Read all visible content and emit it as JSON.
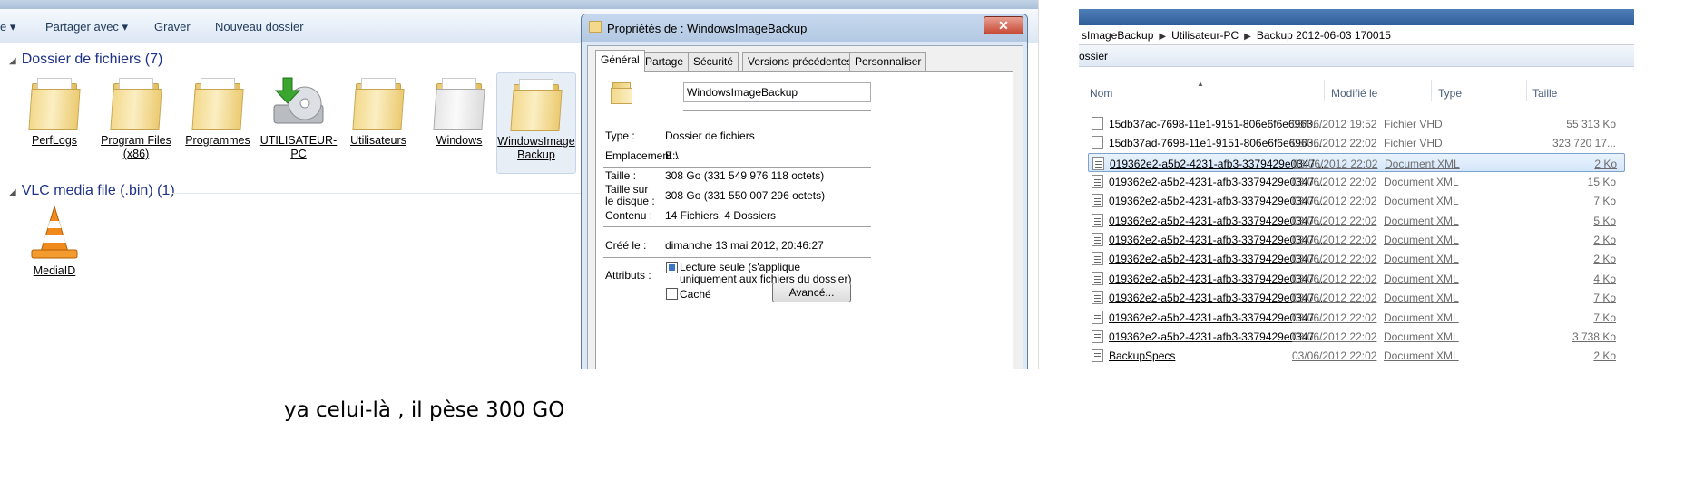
{
  "left_explorer": {
    "toolbar": [
      "e ▾",
      "Partager avec ▾",
      "Graver",
      "Nouveau dossier"
    ],
    "group1": "Dossier de fichiers (7)",
    "folders": [
      "PerfLogs",
      "Program Files (x86)",
      "Programmes",
      "UTILISATEUR-PC",
      "Utilisateurs",
      "Windows",
      "WindowsImageBackup"
    ],
    "group2": "VLC media file (.bin) (1)",
    "media_item": "MediaID"
  },
  "dialog": {
    "title": "Propriétés de : WindowsImageBackup",
    "close_glyph": "✕",
    "tabs": [
      "Général",
      "Partage",
      "Sécurité",
      "Versions précédentes",
      "Personnaliser"
    ],
    "name": "WindowsImageBackup",
    "type_label": "Type :",
    "type_value": "Dossier de fichiers",
    "location_label": "Emplacement :",
    "location_value": "E:\\",
    "size_label": "Taille :",
    "size_value": "308 Go (331 549 976 118 octets)",
    "disk_size_label": "Taille sur le disque :",
    "disk_size_value": "308 Go (331 550 007 296 octets)",
    "contents_label": "Contenu :",
    "contents_value": "14 Fichiers, 4 Dossiers",
    "created_label": "Créé le :",
    "created_value": "dimanche 13 mai 2012, 20:46:27",
    "attributes_label": "Attributs :",
    "readonly_label": "Lecture seule (s'applique uniquement aux fichiers du dossier)",
    "hidden_label": "Caché",
    "advanced_button": "Avancé..."
  },
  "right_explorer": {
    "breadcrumb": [
      "sImageBackup",
      "Utilisateur-PC",
      "Backup 2012-06-03 170015"
    ],
    "toolbar_text": "ossier",
    "columns": [
      "Nom",
      "Modifié le",
      "Type",
      "Taille"
    ],
    "rows": [
      {
        "name": "15db37ac-7698-11e1-9151-806e6f6e6963....",
        "date": "03/06/2012 19:52",
        "type": "Fichier VHD",
        "size": "55 313 Ko",
        "icon": "file-icon"
      },
      {
        "name": "15db37ad-7698-11e1-9151-806e6f6e6963....",
        "date": "03/06/2012 22:02",
        "type": "Fichier VHD",
        "size": "323 720 17...",
        "icon": "file-icon"
      },
      {
        "name": "019362e2-a5b2-4231-afb3-3379429e0347 ...",
        "date": "03/06/2012 22:02",
        "type": "Document XML",
        "size": "2 Ko",
        "icon": "xml-icon"
      },
      {
        "name": "019362e2-a5b2-4231-afb3-3379429e0347 ...",
        "date": "03/06/2012 22:02",
        "type": "Document XML",
        "size": "15 Ko",
        "icon": "xml-icon"
      },
      {
        "name": "019362e2-a5b2-4231-afb3-3379429e0347 ...",
        "date": "03/06/2012 22:02",
        "type": "Document XML",
        "size": "7 Ko",
        "icon": "xml-icon"
      },
      {
        "name": "019362e2-a5b2-4231-afb3-3379429e0347 ...",
        "date": "03/06/2012 22:02",
        "type": "Document XML",
        "size": "5 Ko",
        "icon": "xml-icon"
      },
      {
        "name": "019362e2-a5b2-4231-afb3-3379429e0347 ...",
        "date": "03/06/2012 22:02",
        "type": "Document XML",
        "size": "2 Ko",
        "icon": "xml-icon"
      },
      {
        "name": "019362e2-a5b2-4231-afb3-3379429e0347 ...",
        "date": "03/06/2012 22:02",
        "type": "Document XML",
        "size": "2 Ko",
        "icon": "xml-icon"
      },
      {
        "name": "019362e2-a5b2-4231-afb3-3379429e0347 ...",
        "date": "03/06/2012 22:02",
        "type": "Document XML",
        "size": "4 Ko",
        "icon": "xml-icon"
      },
      {
        "name": "019362e2-a5b2-4231-afb3-3379429e0347 ...",
        "date": "03/06/2012 22:02",
        "type": "Document XML",
        "size": "7 Ko",
        "icon": "xml-icon"
      },
      {
        "name": "019362e2-a5b2-4231-afb3-3379429e0347 ...",
        "date": "03/06/2012 22:02",
        "type": "Document XML",
        "size": "7 Ko",
        "icon": "xml-icon"
      },
      {
        "name": "019362e2-a5b2-4231-afb3-3379429e0347 ...",
        "date": "03/06/2012 22:02",
        "type": "Document XML",
        "size": "3 738 Ko",
        "icon": "xml-icon"
      },
      {
        "name": "BackupSpecs",
        "date": "03/06/2012 22:02",
        "type": "Document XML",
        "size": "2 Ko",
        "icon": "xml-icon"
      }
    ],
    "selected_row": 2
  },
  "caption": "ya celui-là , il pèse 300 GO"
}
